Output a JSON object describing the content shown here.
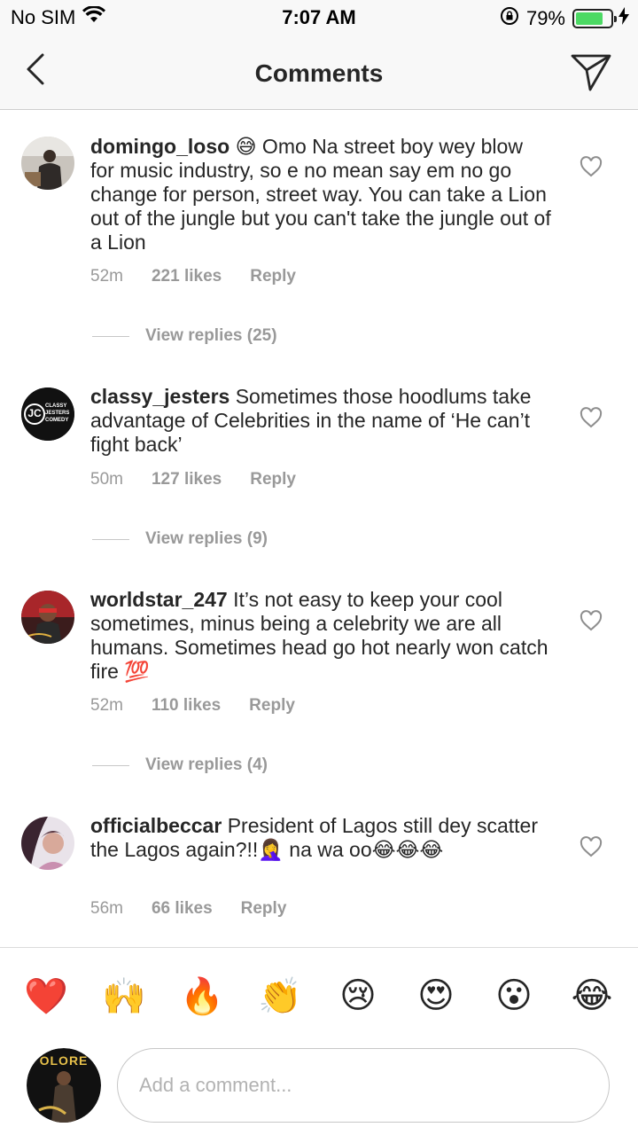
{
  "status_bar": {
    "carrier": "No SIM",
    "time": "7:07 AM",
    "battery": "79%",
    "battery_level": 0.79
  },
  "header": {
    "title": "Comments"
  },
  "comments": [
    {
      "username": "domingo_loso",
      "text": "😅 Omo Na street boy wey blow for music industry, so e no mean say em no go change for person, street way. You can take a Lion out of the jungle but you can't take the jungle out of a Lion",
      "time": "52m",
      "likes": "221 likes",
      "reply": "Reply",
      "view_replies": "View replies (25)"
    },
    {
      "username": "classy_jesters",
      "text": "Sometimes those hoodlums take advantage of Celebrities in the name of ‘He can’t fight back’",
      "time": "50m",
      "likes": "127 likes",
      "reply": "Reply",
      "view_replies": "View replies (9)",
      "avatar_text": [
        "CLASSY",
        "JESTERS",
        "COMEDY"
      ],
      "avatar_logo": "JC"
    },
    {
      "username": "worldstar_247",
      "text": "It’s not easy to keep your cool sometimes, minus being a celebrity we are all humans. Sometimes head go hot nearly won catch fire 💯",
      "time": "52m",
      "likes": "110 likes",
      "reply": "Reply",
      "view_replies": "View replies (4)"
    },
    {
      "username": "officialbeccar",
      "text": "President of Lagos still dey scatter the Lagos again?!!🤦‍♀️ na wa oo😂😂😂",
      "time": "56m",
      "likes": "66 likes",
      "reply": "Reply"
    }
  ],
  "emoji_bar": [
    "❤️",
    "🙌",
    "🔥",
    "👏",
    "😢",
    "😍",
    "😮",
    "😂"
  ],
  "composer": {
    "placeholder": "Add a comment...",
    "avatar_text": "OLORE"
  }
}
